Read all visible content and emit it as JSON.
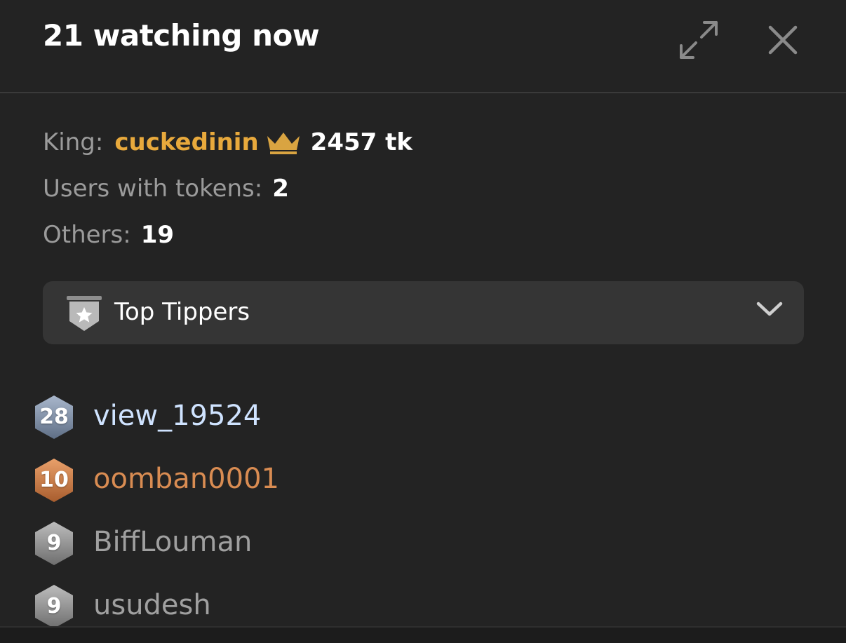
{
  "header": {
    "title": "21 watching now"
  },
  "stats": {
    "king_label": "King:",
    "king_name": "cuckedinin",
    "king_tokens": "2457 tk",
    "users_with_tokens_label": "Users with tokens:",
    "users_with_tokens_value": "2",
    "others_label": "Others:",
    "others_value": "19"
  },
  "dropdown": {
    "label": "Top Tippers"
  },
  "users": [
    {
      "level": "28",
      "name": "view_19524"
    },
    {
      "level": "10",
      "name": "oomban0001"
    },
    {
      "level": "9",
      "name": "BiffLouman"
    },
    {
      "level": "9",
      "name": "usudesh"
    }
  ],
  "colors": {
    "background": "#232323",
    "king": "#e8a93c",
    "level_28_name": "#cfe3ff",
    "level_10_name": "#d98c52",
    "grey_name": "#a0a0a0"
  }
}
